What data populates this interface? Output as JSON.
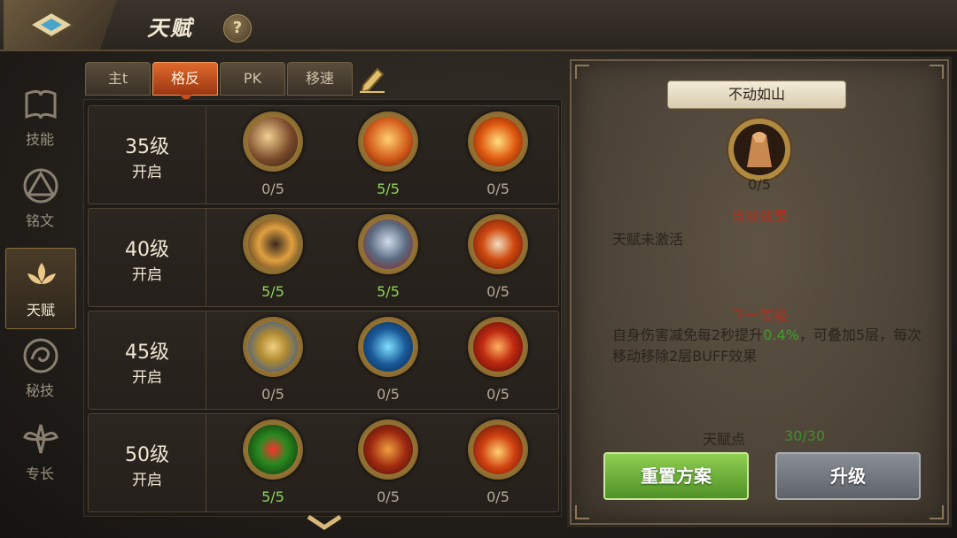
{
  "header": {
    "title": "天赋",
    "help_label": "?"
  },
  "sidenav": {
    "items": [
      {
        "label": "技能",
        "icon": "book-icon",
        "active": false
      },
      {
        "label": "铭文",
        "icon": "inscription-triangle-icon",
        "active": false
      },
      {
        "label": "天赋",
        "icon": "talent-lotus-icon",
        "active": true
      },
      {
        "label": "秘技",
        "icon": "secret-swirl-icon",
        "active": false
      },
      {
        "label": "专长",
        "icon": "specialty-wings-icon",
        "active": false
      }
    ]
  },
  "tabs": [
    {
      "label": "主t",
      "active": false
    },
    {
      "label": "格反",
      "active": true
    },
    {
      "label": "PK",
      "active": false
    },
    {
      "label": "移速",
      "active": false
    }
  ],
  "rows": [
    {
      "level": "35级",
      "unlock": "开启",
      "skills": [
        {
          "icon": "explosion-hammer-icon",
          "count": "0/5",
          "full": false
        },
        {
          "icon": "fire-hands-icon",
          "count": "5/5",
          "full": true
        },
        {
          "icon": "flame-swirl-icon",
          "count": "0/5",
          "full": false
        }
      ]
    },
    {
      "level": "40级",
      "unlock": "开启",
      "skills": [
        {
          "icon": "dark-fist-icon",
          "count": "5/5",
          "full": true
        },
        {
          "icon": "armor-shield-icon",
          "count": "5/5",
          "full": true
        },
        {
          "icon": "fire-spear-icon",
          "count": "0/5",
          "full": false
        }
      ]
    },
    {
      "level": "45级",
      "unlock": "开启",
      "skills": [
        {
          "icon": "gold-shield-icon",
          "count": "0/5",
          "full": false
        },
        {
          "icon": "ice-warrior-icon",
          "count": "0/5",
          "full": false
        },
        {
          "icon": "blood-blade-icon",
          "count": "0/5",
          "full": false
        }
      ]
    },
    {
      "level": "50级",
      "unlock": "开启",
      "skills": [
        {
          "icon": "green-heart-icon",
          "count": "5/5",
          "full": true
        },
        {
          "icon": "fire-demon-icon",
          "count": "0/5",
          "full": false
        },
        {
          "icon": "flame-fist-icon",
          "count": "0/5",
          "full": false
        }
      ]
    }
  ],
  "detail": {
    "name": "不动如山",
    "icon": "mountain-rock-icon",
    "count": "0/5",
    "current_heading": "当前效果",
    "current_text": "天赋未激活",
    "next_heading": "下一等级",
    "next_text_a": "自身伤害减免每2秒提升",
    "next_text_value": "0.4%",
    "next_text_b": "，可叠加5层，每次移动移除2层BUFF效果",
    "points_label": "天赋点",
    "points_value": "30/30",
    "reset_label": "重置方案",
    "upgrade_label": "升级"
  },
  "colors": {
    "accent_orange": "#d4601f",
    "full_green": "#8fd35a",
    "effect_red": "#b0301c"
  }
}
